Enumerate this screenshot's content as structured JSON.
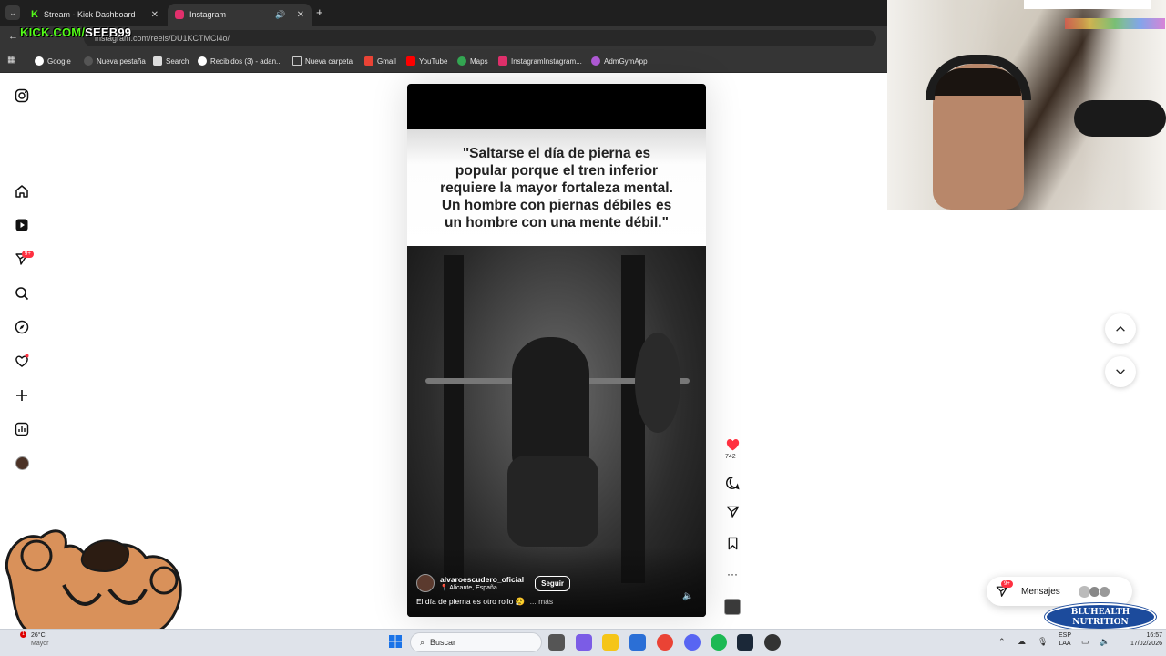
{
  "browser": {
    "tabs": [
      {
        "title": "Stream - Kick Dashboard",
        "active": false
      },
      {
        "title": "Instagram",
        "active": true
      }
    ],
    "url": "instagram.com/reels/DU1KCTMCl4o/",
    "bookmarks": [
      "Google",
      "Nueva pestaña",
      "Search",
      "Recibidos (3) - adan...",
      "Nueva carpeta",
      "Gmail",
      "YouTube",
      "Maps",
      "InstagramInstagram...",
      "AdmGymApp"
    ]
  },
  "overlay": {
    "kick_prefix": "KICK.COM/",
    "kick_user": "SEEB99"
  },
  "sidebar": {
    "notifications_badge": "9+"
  },
  "reel": {
    "quote": "\"Saltarse el día de pierna es popular porque el tren inferior requiere la mayor fortaleza mental. Un hombre con piernas débiles es un hombre con una mente débil.\"",
    "author": "alvaroescudero_oficial",
    "location": "Alicante, España",
    "follow_label": "Seguir",
    "caption": "El día de pierna es otro rollo 😮‍💨",
    "more_label": "... más",
    "likes": "742"
  },
  "messages": {
    "label": "Mensajes",
    "badge": "9+"
  },
  "taskbar": {
    "weather_temp": "26°C",
    "weather_desc": "Mayor",
    "search_placeholder": "Buscar",
    "lang_top": "ESP",
    "lang_bottom": "LAA",
    "time": "16:57",
    "date": "17/02/2026",
    "weather_badge": "1"
  },
  "sponsor": {
    "line1": "BLUHEALTH",
    "line2": "NUTRITION"
  },
  "colors": {
    "kick_green": "#53fc18",
    "like_red": "#ff3040",
    "instagram_pink": "#e1306c"
  }
}
